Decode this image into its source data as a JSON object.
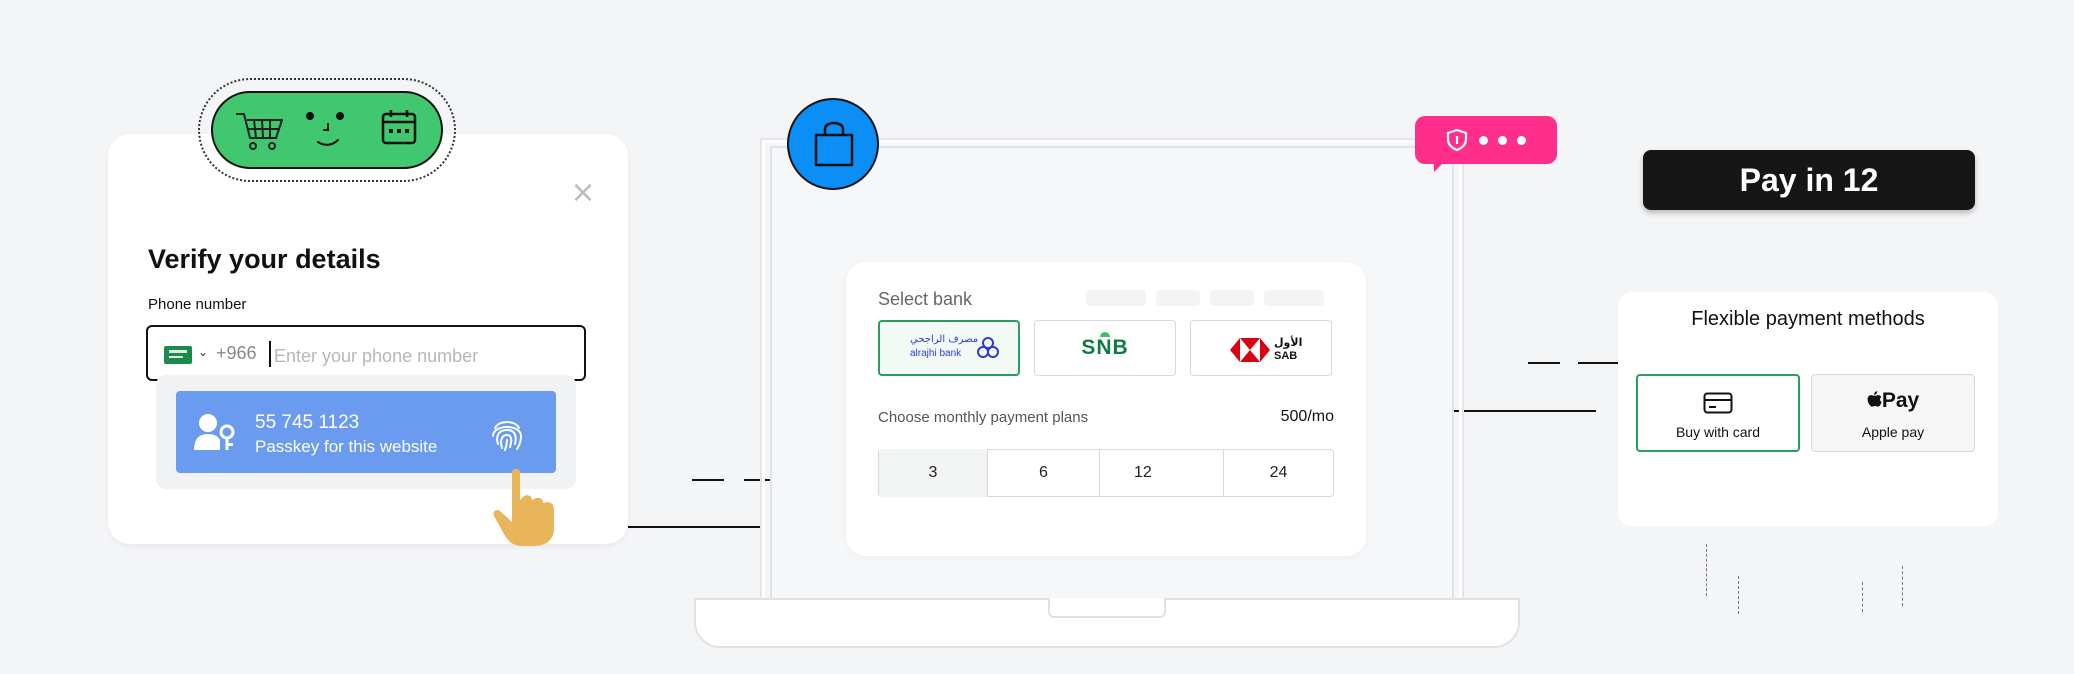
{
  "verify": {
    "title": "Verify your details",
    "close_glyph": "×",
    "phone_label": "Phone number",
    "country_code": "+966",
    "country_flag": "saudi-arabia-flag",
    "phone_placeholder": "Enter your phone number",
    "phone_value": "",
    "passkey": {
      "number": "55 745 1123",
      "subtitle": "Passkey for this website",
      "icon": "user-key-icon",
      "fingerprint_icon": "fingerprint-icon"
    }
  },
  "icon_pill": {
    "icons": [
      "shopping-cart-icon",
      "smiley-face-icon",
      "calendar-icon"
    ],
    "color": "#41c76f"
  },
  "laptop": {
    "badge_icon": "shopping-bag-icon",
    "badge_color": "#0b8ff7",
    "notification": {
      "icon": "shield-icon",
      "color": "#ff2e8a"
    }
  },
  "bank_selection": {
    "title": "Select bank",
    "banks": [
      {
        "name_ar": "مصرف الراجحي",
        "name_en": "alrajhi bank",
        "selected": true
      },
      {
        "name": "SNB",
        "selected": false
      },
      {
        "name_ar": "الأول",
        "name_en": "SAB",
        "selected": false
      }
    ],
    "plans_label": "Choose monthly payment plans",
    "plan_amount": "500/mo",
    "plans": [
      "3",
      "6",
      "12",
      "24"
    ],
    "selected_plan": "3"
  },
  "pay_in": {
    "label": "Pay in 12"
  },
  "payment_methods": {
    "title": "Flexible payment methods",
    "options": [
      {
        "label": "Buy with card",
        "icon": "credit-card-icon",
        "selected": true
      },
      {
        "label": "Apple pay",
        "logo_text": "Pay",
        "icon": "apple-logo-icon",
        "selected": false
      }
    ]
  },
  "colors": {
    "accent_green": "#2a9d63",
    "passkey_blue": "#6b9bef",
    "dark": "#161616"
  }
}
